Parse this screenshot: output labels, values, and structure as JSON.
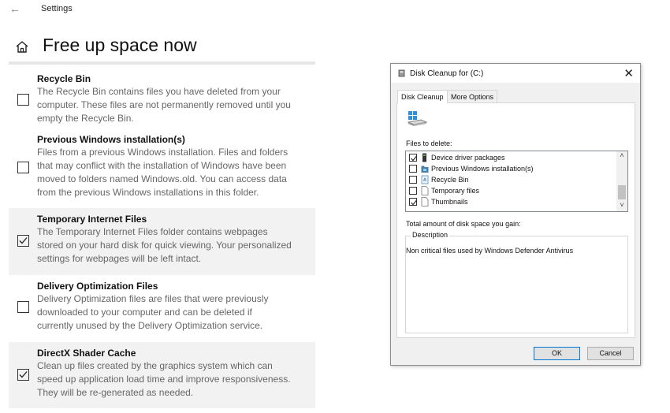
{
  "settings": {
    "back_icon": "back-arrow-icon",
    "app_title": "Settings",
    "page_title": "Free up space now",
    "items": [
      {
        "title": "Recycle Bin",
        "checked": false,
        "desc": [
          "The Recycle Bin contains files you have deleted from your",
          "computer. These files are not permanently removed until you",
          "empty the Recycle Bin."
        ]
      },
      {
        "title": "Previous Windows installation(s)",
        "checked": false,
        "desc": [
          "Files from a previous Windows installation.  Files and folders",
          "that may conflict with the installation of Windows have been",
          "moved to folders named Windows.old.  You can access data",
          "from the previous Windows installations in this folder."
        ]
      },
      {
        "title": "Temporary Internet Files",
        "checked": true,
        "desc": [
          "The Temporary Internet Files folder contains webpages",
          "stored on your hard disk for quick viewing. Your personalized",
          "settings for webpages will be left intact."
        ]
      },
      {
        "title": "Delivery Optimization Files",
        "checked": false,
        "desc": [
          "Delivery Optimization files are files that were previously",
          "downloaded to your computer and can be deleted if",
          "currently unused by the Delivery Optimization service."
        ]
      },
      {
        "title": "DirectX Shader Cache",
        "checked": true,
        "desc": [
          "Clean up files created by the graphics system which can",
          "speed up application load time and improve responsiveness.",
          "They will be re-generated as needed."
        ]
      }
    ]
  },
  "dialog": {
    "title": "Disk Cleanup for  (C:)",
    "close_glyph": "✕",
    "tabs": [
      "Disk Cleanup",
      "More Options"
    ],
    "files_label": "Files to delete:",
    "files": [
      {
        "name": "Device driver packages",
        "checked": true,
        "icon": "device-driver-icon"
      },
      {
        "name": "Previous Windows installation(s)",
        "checked": false,
        "icon": "windows-folder-icon"
      },
      {
        "name": "Recycle Bin",
        "checked": false,
        "icon": "recycle-bin-icon"
      },
      {
        "name": "Temporary files",
        "checked": false,
        "icon": "blank-file-icon"
      },
      {
        "name": "Thumbnails",
        "checked": true,
        "icon": "blank-file-icon"
      }
    ],
    "total_label": "Total amount of disk space you gain:",
    "description_legend": "Description",
    "description_text": "Non critical files used by Windows Defender Antivirus",
    "ok_label": "OK",
    "cancel_label": "Cancel",
    "scroll_up": "˄",
    "scroll_down": "˅"
  }
}
